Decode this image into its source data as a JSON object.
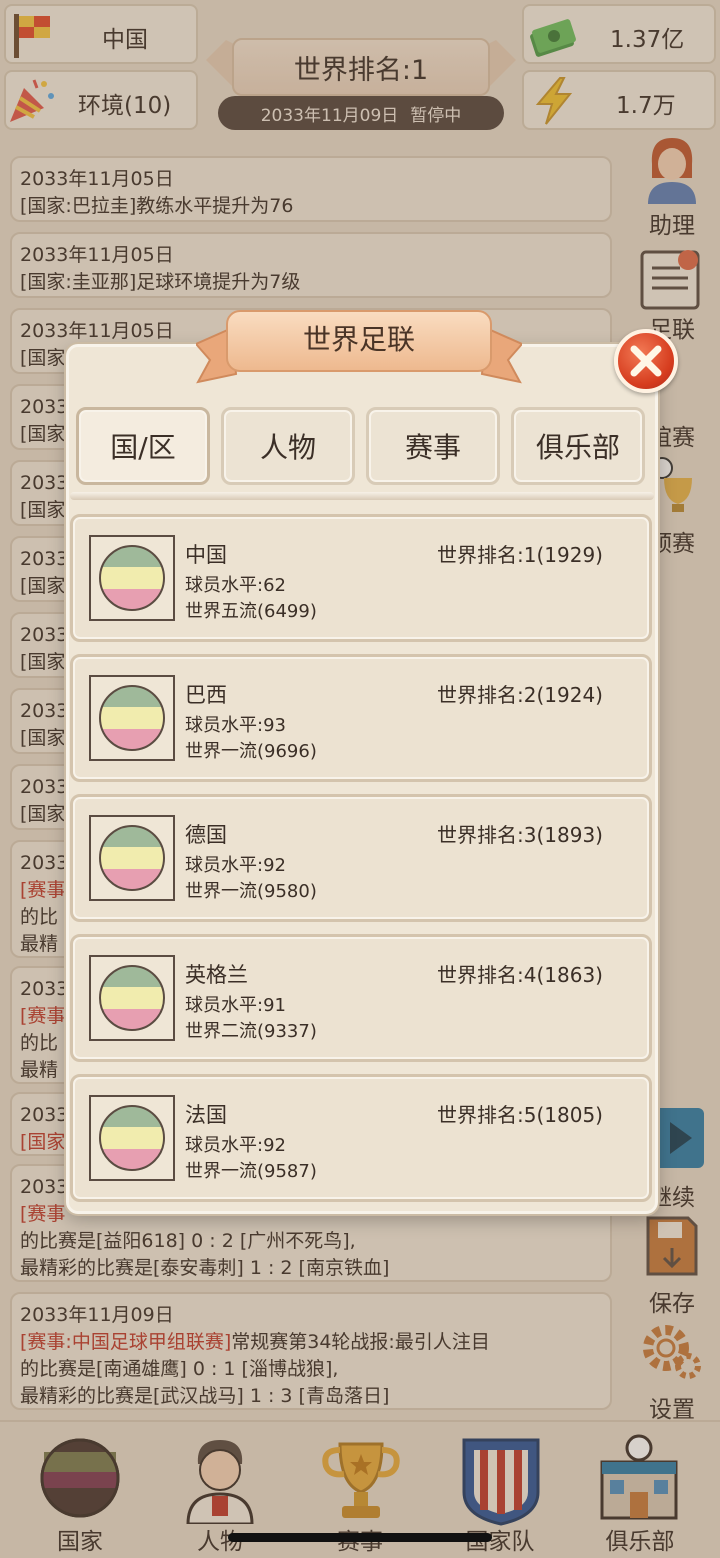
{
  "top": {
    "country": "中国",
    "environment": "环境(10)",
    "money": "1.37亿",
    "energy": "1.7万",
    "world_rank_title": "世界排名:1",
    "date": "2033年11月09日",
    "status": "暂停中"
  },
  "news": [
    {
      "date": "2033年11月05日",
      "text": "[国家:巴拉圭]教练水平提升为76"
    },
    {
      "date": "2033年11月05日",
      "text": "[国家:圭亚那]足球环境提升为7级"
    },
    {
      "date": "2033年11月05日",
      "text": "[国家"
    },
    {
      "date": "2033",
      "text": "[国家"
    },
    {
      "date": "2033",
      "text": "[国家"
    },
    {
      "date": "2033",
      "text": "[国家"
    },
    {
      "date": "2033",
      "text": "[国家"
    },
    {
      "date": "2033",
      "text": "[国家"
    },
    {
      "date": "2033",
      "text": "[国家"
    },
    {
      "date": "2033",
      "red": "[赛事",
      "l2": "的比",
      "l3": "最精"
    },
    {
      "date": "2033",
      "red": "[赛事",
      "l2": "的比",
      "l3": "最精"
    },
    {
      "date": "2033",
      "red": "[国家"
    },
    {
      "date": "2033",
      "red": "[赛事",
      "l2": "的比赛是[益阳618] 0 : 2 [广州不死鸟],",
      "l3": "最精彩的比赛是[泰安毒刺] 1 : 2 [南京铁血]"
    },
    {
      "date": "2033年11月09日",
      "red": "[赛事:中国足球甲组联赛]",
      "rest": "常规赛第34轮战报:最引人注目",
      "l2": "的比赛是[南通雄鹰] 0 : 1 [淄博战狼],",
      "l3": "最精彩的比赛是[武汉战马] 1 : 3 [青岛落日]"
    }
  ],
  "side_menu": {
    "assistant": "助理",
    "federation": "足联",
    "friendly": "谊赛",
    "qualifier": "预赛",
    "continue": "继续",
    "save": "保存",
    "settings": "设置"
  },
  "bottom_nav": {
    "country": "国家",
    "people": "人物",
    "events": "赛事",
    "national_team": "国家队",
    "club": "俱乐部"
  },
  "modal": {
    "title": "世界足联",
    "tabs": [
      "国/区",
      "人物",
      "赛事",
      "俱乐部"
    ],
    "countries": [
      {
        "name": "中国",
        "level": "球员水平:62",
        "tier": "世界五流(6499)",
        "rank": "世界排名:1(1929)"
      },
      {
        "name": "巴西",
        "level": "球员水平:93",
        "tier": "世界一流(9696)",
        "rank": "世界排名:2(1924)"
      },
      {
        "name": "德国",
        "level": "球员水平:92",
        "tier": "世界一流(9580)",
        "rank": "世界排名:3(1893)"
      },
      {
        "name": "英格兰",
        "level": "球员水平:91",
        "tier": "世界二流(9337)",
        "rank": "世界排名:4(1863)"
      },
      {
        "name": "法国",
        "level": "球员水平:92",
        "tier": "世界一流(9587)",
        "rank": "世界排名:5(1805)"
      }
    ]
  },
  "colors": {
    "flag_top": "#9fb99a",
    "flag_mid": "#f1ecae",
    "flag_bottom": "#e79fb1",
    "accent_red": "#c0392b"
  }
}
